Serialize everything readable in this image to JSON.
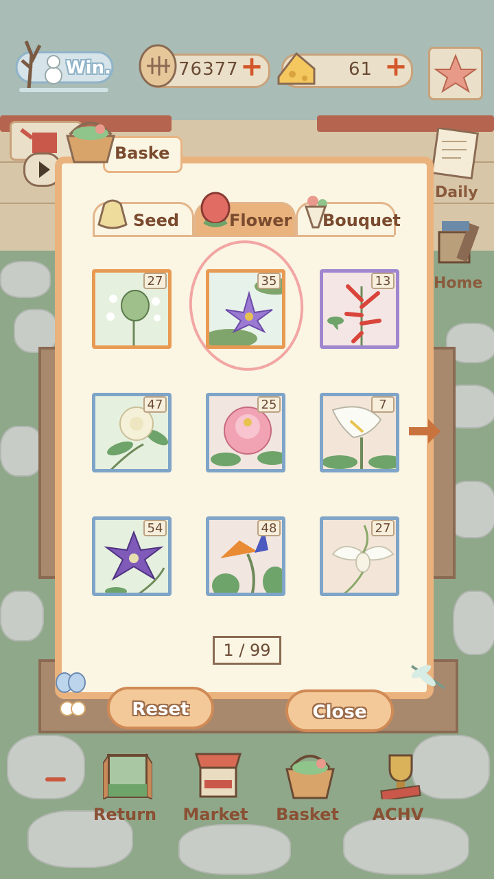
{
  "hud": {
    "weather_label": "Win.",
    "coins": "76377",
    "cheese": "61"
  },
  "side": {
    "daily_label": "Daily",
    "home_label": "Home"
  },
  "panel": {
    "title": "Baske",
    "tabs": [
      {
        "label": "Seed",
        "active": false
      },
      {
        "label": "Flower",
        "active": true
      },
      {
        "label": "Bouquet",
        "active": false
      }
    ],
    "items": [
      {
        "count": "27",
        "frame": "orange",
        "flower": "white-allium-icon"
      },
      {
        "count": "35",
        "frame": "orange",
        "flower": "water-lily-icon"
      },
      {
        "count": "13",
        "frame": "purple",
        "flower": "red-trumpet-flower-icon"
      },
      {
        "count": "47",
        "frame": "blue",
        "flower": "gardenia-icon"
      },
      {
        "count": "25",
        "frame": "blue",
        "flower": "peony-icon"
      },
      {
        "count": "7",
        "frame": "blue",
        "flower": "calla-lily-icon"
      },
      {
        "count": "54",
        "frame": "blue",
        "flower": "clematis-icon"
      },
      {
        "count": "48",
        "frame": "blue",
        "flower": "bird-of-paradise-icon"
      },
      {
        "count": "27",
        "frame": "blue",
        "flower": "white-egret-orchid-icon"
      }
    ],
    "pager": "1 / 99",
    "reset_label": "Reset",
    "close_label": "Close"
  },
  "dock": [
    {
      "label": "Return",
      "icon": "window-icon"
    },
    {
      "label": "Market",
      "icon": "market-stall-icon"
    },
    {
      "label": "Basket",
      "icon": "basket-icon"
    },
    {
      "label": "ACHV",
      "icon": "trophy-icon"
    }
  ],
  "colors": {
    "panel_border": "#eab27c",
    "panel_bg": "#fbf5e3",
    "frame_orange": "#e89a52",
    "frame_blue": "#7ea4c8",
    "frame_purple": "#9f86cf",
    "text_brown": "#7a4b2f",
    "highlight": "#f2a6a3"
  }
}
